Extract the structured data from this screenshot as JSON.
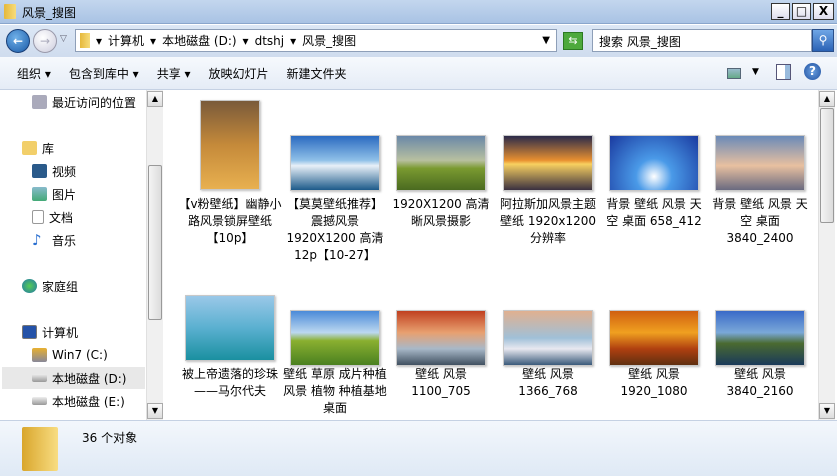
{
  "window": {
    "title": "风景_搜图",
    "minimize": "_",
    "maximize": "□",
    "close": "X"
  },
  "address": {
    "crumbs": [
      "计算机",
      "本地磁盘 (D:)",
      "dtshj",
      "风景_搜图"
    ],
    "search_placeholder": "搜索 风景_搜图"
  },
  "toolbar": {
    "organize": "组织 ▾",
    "include": "包含到库中 ▾",
    "share": "共享 ▾",
    "slideshow": "放映幻灯片",
    "new_folder": "新建文件夹"
  },
  "nav": {
    "recent": "最近访问的位置",
    "library": "库",
    "video": "视频",
    "pictures": "图片",
    "docs": "文档",
    "music": "音乐",
    "homegroup": "家庭组",
    "computer": "计算机",
    "c": "Win7 (C:)",
    "d": "本地磁盘 (D:)",
    "e": "本地磁盘 (E:)"
  },
  "files": [
    {
      "name": "【v粉壁纸】幽静小路风景锁屏壁纸 【10p】"
    },
    {
      "name": "【莫莫壁纸推荐】震撼风景 1920X1200 高清12p【10-27】"
    },
    {
      "name": "1920X1200 高清晰风景摄影"
    },
    {
      "name": "阿拉斯加风景主题壁纸 1920x1200分辨率"
    },
    {
      "name": "背景 壁纸 风景 天空 桌面 658_412"
    },
    {
      "name": "背景 壁纸 风景 天空 桌面 3840_2400"
    },
    {
      "name": "被上帝遗落的珍珠——马尔代夫"
    },
    {
      "name": "壁纸 草原 成片种植 风景 植物 种植基地 桌面"
    },
    {
      "name": "壁纸 风景 1100_705"
    },
    {
      "name": "壁纸 风景 1366_768"
    },
    {
      "name": "壁纸 风景 1920_1080"
    },
    {
      "name": "壁纸 风景 3840_2160"
    }
  ],
  "status": {
    "count": "36 个对象"
  }
}
